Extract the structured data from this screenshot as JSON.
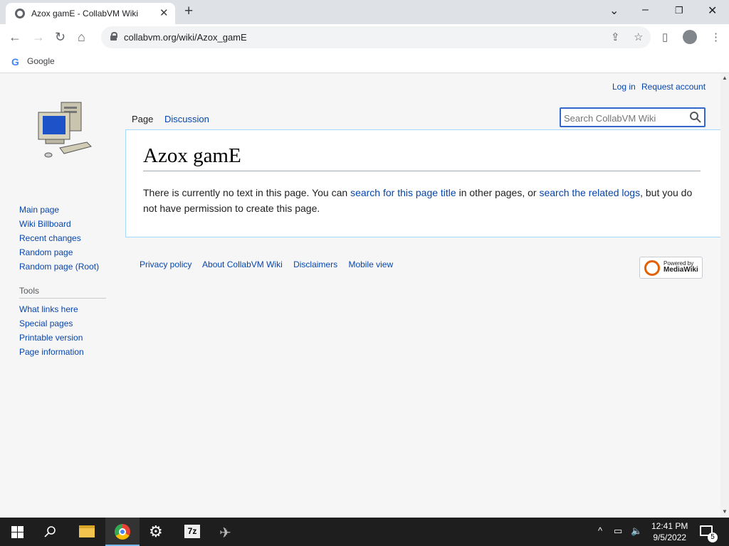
{
  "browser": {
    "tab_title": "Azox gamE - CollabVM Wiki",
    "tab_close": "✕",
    "new_tab": "+",
    "url": "collabvm.org/wiki/Azox_gamE",
    "bookmarks": [
      {
        "label": "Google"
      }
    ]
  },
  "wiki": {
    "personal": {
      "login": "Log in",
      "request": "Request account"
    },
    "tabs": {
      "page": "Page",
      "discussion": "Discussion"
    },
    "search_placeholder": "Search CollabVM Wiki",
    "title": "Azox gamE",
    "body": {
      "part1": "There is currently no text in this page. You can ",
      "link1": "search for this page title",
      "part2": " in other pages, or ",
      "link2": "search the related logs",
      "part3": ", but you do not have permission to create this page."
    },
    "nav_links": [
      "Main page",
      "Wiki Billboard",
      "Recent changes",
      "Random page",
      "Random page (Root)"
    ],
    "tools_heading": "Tools",
    "tools_links": [
      "What links here",
      "Special pages",
      "Printable version",
      "Page information"
    ],
    "footer_links": [
      "Privacy policy",
      "About CollabVM Wiki",
      "Disclaimers",
      "Mobile view"
    ],
    "powered": {
      "line1": "Powered by",
      "line2": "MediaWiki"
    }
  },
  "taskbar": {
    "time": "12:41 PM",
    "date": "9/5/2022",
    "notification_count": "5"
  },
  "colors": {
    "link": "#0645ad",
    "search_border": "#3366cc",
    "taskbar": "#1e1e1e"
  }
}
